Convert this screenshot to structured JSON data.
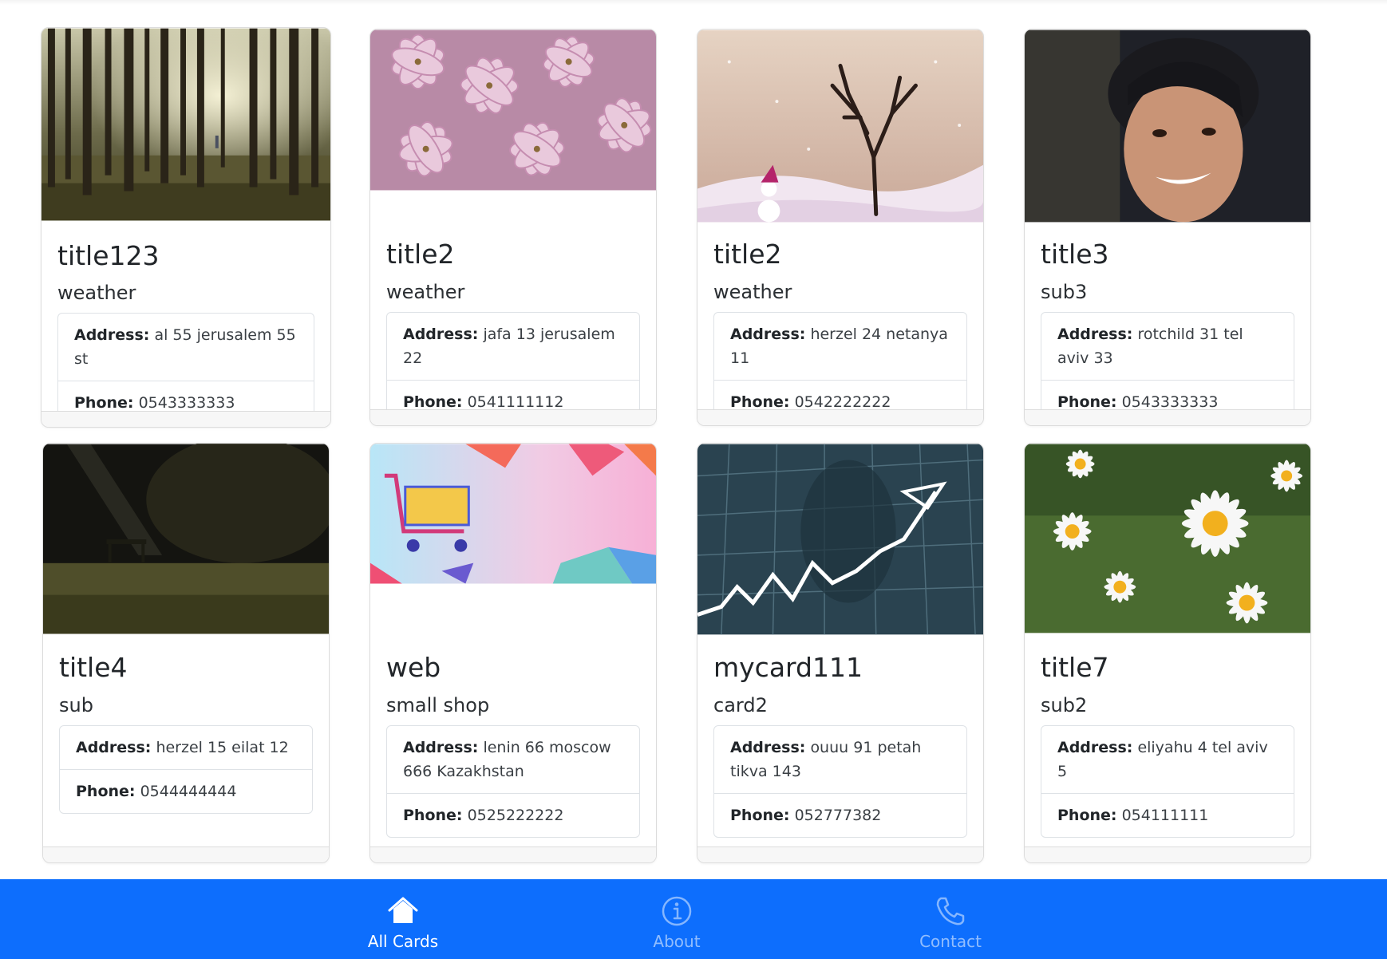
{
  "cards": [
    {
      "title": "title123",
      "subtitle": "weather",
      "address_label": "Address:",
      "address": "al 55 jerusalem 55 st",
      "phone_label": "Phone:",
      "phone": "0543333333",
      "image": "forest-image"
    },
    {
      "title": "title2",
      "subtitle": "weather",
      "address_label": "Address:",
      "address": "jafa 13 jerusalem 22",
      "phone_label": "Phone:",
      "phone": "0541111112",
      "image": "pink-flowers-image"
    },
    {
      "title": "title2",
      "subtitle": "weather",
      "address_label": "Address:",
      "address": "herzel 24 netanya 11",
      "phone_label": "Phone:",
      "phone": "0542222222",
      "image": "winter-tree-image"
    },
    {
      "title": "title3",
      "subtitle": "sub3",
      "address_label": "Address:",
      "address": "rotchild 31 tel aviv 33",
      "phone_label": "Phone:",
      "phone": "0543333333",
      "image": "smiling-boy-image"
    },
    {
      "title": "title4",
      "subtitle": "sub",
      "address_label": "Address:",
      "address": "herzel 15 eilat 12",
      "phone_label": "Phone:",
      "phone": "0544444444",
      "image": "dark-park-bench-image"
    },
    {
      "title": "web",
      "subtitle": "small shop",
      "address_label": "Address:",
      "address": "lenin 66 moscow 666 Kazakhstan",
      "phone_label": "Phone:",
      "phone": "0525222222",
      "image": "shopping-cart-image"
    },
    {
      "title": "mycard111",
      "subtitle": "card2",
      "address_label": "Address:",
      "address": "ouuu 91 petah tikva 143",
      "phone_label": "Phone:",
      "phone": "052777382",
      "image": "stock-chart-image"
    },
    {
      "title": "title7",
      "subtitle": "sub2",
      "address_label": "Address:",
      "address": "eliyahu 4 tel aviv 5",
      "phone_label": "Phone:",
      "phone": "054111111",
      "image": "daisies-image"
    }
  ],
  "navbar": {
    "items": [
      {
        "label": "All Cards",
        "icon": "home-icon",
        "active": true
      },
      {
        "label": "About",
        "icon": "info-icon",
        "active": false
      },
      {
        "label": "Contact",
        "icon": "phone-icon",
        "active": false
      }
    ]
  },
  "colors": {
    "primary": "#0d6efd",
    "nav_active": "#ffffff",
    "nav_inactive": "#85b6fe"
  }
}
